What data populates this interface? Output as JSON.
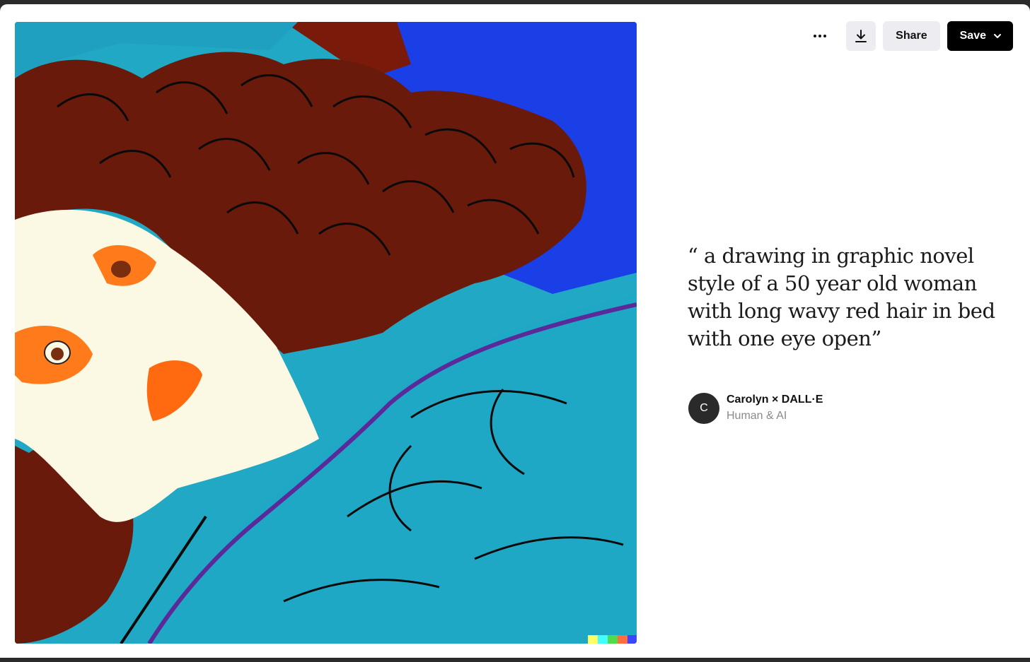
{
  "toolbar": {
    "more_icon": "more-dots-icon",
    "download_icon": "download-icon",
    "share_label": "Share",
    "save_label": "Save",
    "save_icon": "chevron-down-icon"
  },
  "image": {
    "description": "",
    "watermark_colors": [
      "#ffff66",
      "#42ffff",
      "#51da4c",
      "#ff6e3c",
      "#3c46ff"
    ]
  },
  "prompt": {
    "text": "“ a drawing in graphic novel style of a 50 year old woman with long wavy red hair in bed with one eye open”"
  },
  "author": {
    "initial": "C",
    "name": "Carolyn × DALL·E",
    "subtitle": "Human & AI"
  },
  "colors": {
    "save_bg": "#000000",
    "secondary_btn_bg": "#ececf1"
  }
}
